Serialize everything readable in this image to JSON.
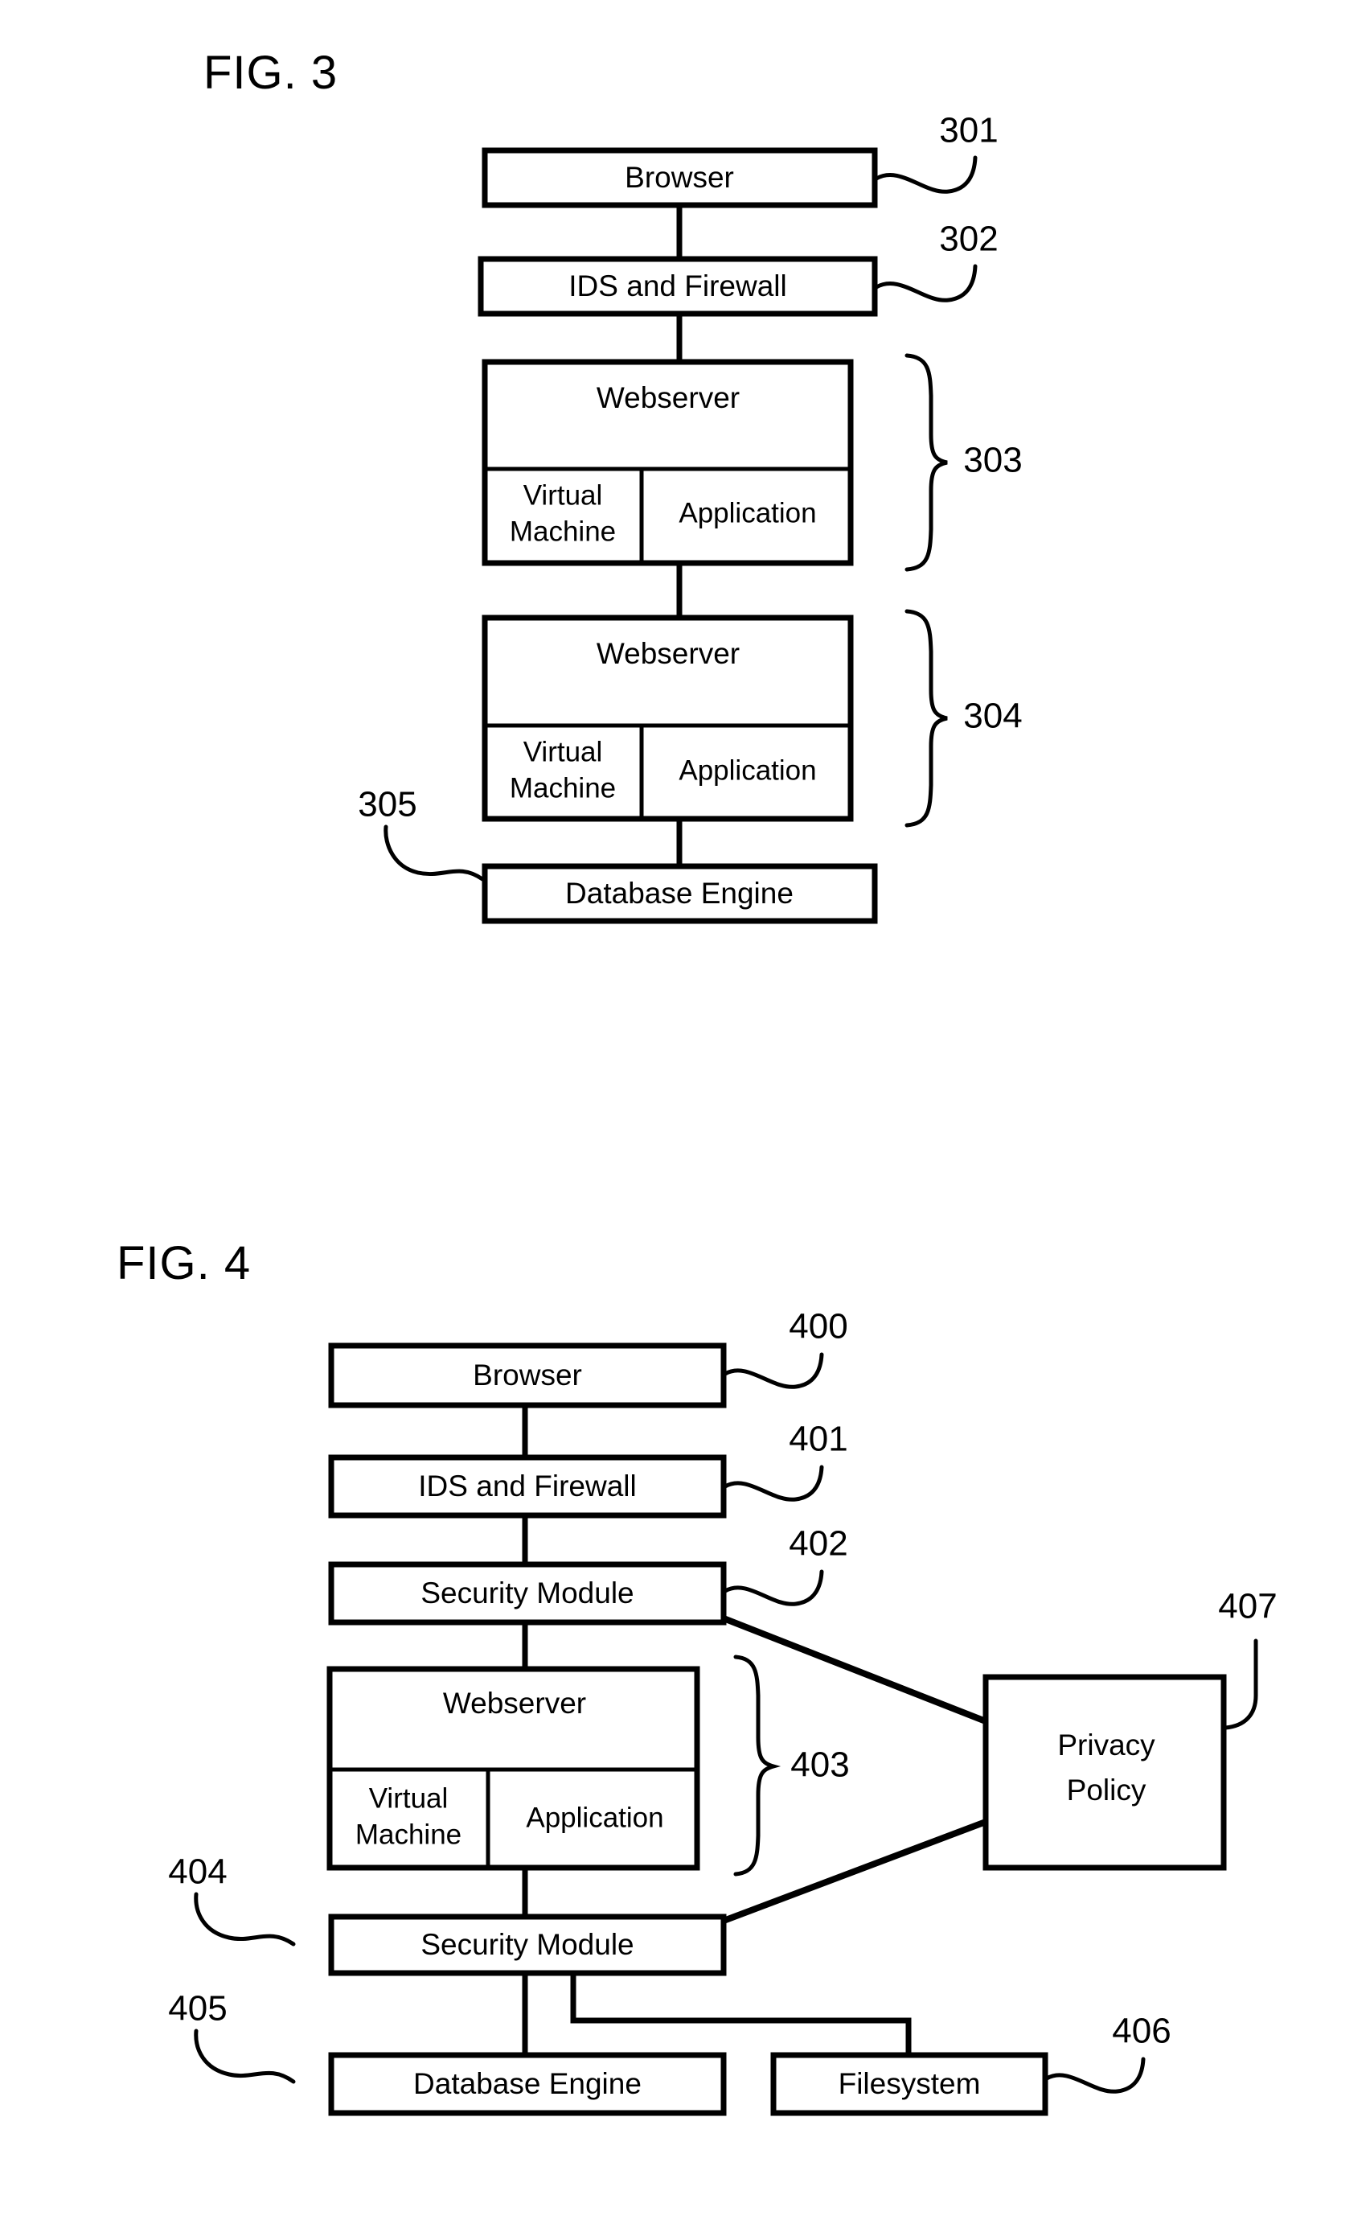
{
  "document": {
    "type": "patent-drawing-sheet",
    "background_color": "#ffffff",
    "ink_color": "#000000"
  },
  "figures": [
    {
      "id": "fig3",
      "title": "FIG. 3",
      "nodes": [
        {
          "key": "browser",
          "label": "Browser",
          "ref": "301"
        },
        {
          "key": "ids_firewall",
          "label": "IDS and Firewall",
          "ref": "302"
        },
        {
          "key": "webserver_1",
          "label": "Webserver",
          "ref": "303"
        },
        {
          "key": "virtual_machine_1",
          "label_line1": "Virtual",
          "label_line2": "Machine"
        },
        {
          "key": "application_1",
          "label": "Application"
        },
        {
          "key": "webserver_2",
          "label": "Webserver",
          "ref": "304"
        },
        {
          "key": "virtual_machine_2",
          "label_line1": "Virtual",
          "label_line2": "Machine"
        },
        {
          "key": "application_2",
          "label": "Application"
        },
        {
          "key": "database_engine",
          "label": "Database Engine",
          "ref": "305"
        }
      ],
      "ref_numbers": [
        "301",
        "302",
        "303",
        "304",
        "305"
      ]
    },
    {
      "id": "fig4",
      "title": "FIG. 4",
      "nodes": [
        {
          "key": "browser",
          "label": "Browser",
          "ref": "400"
        },
        {
          "key": "ids_firewall",
          "label": "IDS and Firewall",
          "ref": "401"
        },
        {
          "key": "security_module_top",
          "label": "Security Module",
          "ref": "402"
        },
        {
          "key": "webserver",
          "label": "Webserver",
          "ref": "403"
        },
        {
          "key": "virtual_machine",
          "label_line1": "Virtual",
          "label_line2": "Machine"
        },
        {
          "key": "application",
          "label": "Application"
        },
        {
          "key": "security_module_bottom",
          "label": "Security Module",
          "ref": "404"
        },
        {
          "key": "database_engine",
          "label": "Database Engine",
          "ref": "405"
        },
        {
          "key": "filesystem",
          "label": "Filesystem",
          "ref": "406"
        },
        {
          "key": "privacy_policy",
          "label_line1": "Privacy",
          "label_line2": "Policy",
          "ref": "407"
        }
      ],
      "ref_numbers": [
        "400",
        "401",
        "402",
        "403",
        "404",
        "405",
        "406",
        "407"
      ]
    }
  ]
}
